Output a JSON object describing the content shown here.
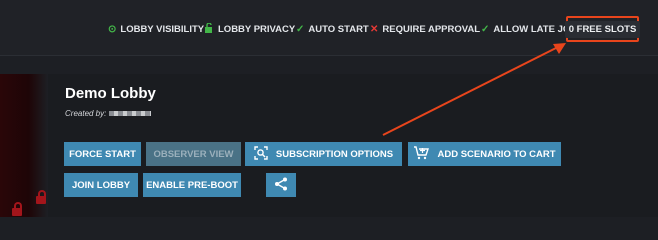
{
  "status_bar": {
    "items": [
      {
        "label": "LOBBY VISIBILITY",
        "icon": "eye-icon"
      },
      {
        "label": "LOBBY PRIVACY",
        "icon": "unlock-icon"
      },
      {
        "label": "AUTO START",
        "icon": "check-icon"
      },
      {
        "label": "REQUIRE APPROVAL",
        "icon": "x-icon"
      },
      {
        "label": "ALLOW LATE JOIN",
        "icon": "check-icon"
      }
    ],
    "free_slots": "0 FREE SLOTS"
  },
  "lobby": {
    "title": "Demo Lobby",
    "created_by_label": "Created by:"
  },
  "buttons": {
    "force_start": "FORCE START",
    "observer_view": "OBSERVER VIEW",
    "subscription_options": "SUBSCRIPTION OPTIONS",
    "add_scenario_to_cart": "ADD SCENARIO TO CART",
    "join_lobby": "JOIN LOBBY",
    "enable_pre_boot": "ENABLE PRE-BOOT"
  },
  "colors": {
    "accent_button": "#3f89b2",
    "highlight": "#e8451c",
    "status_check": "#43b649",
    "status_x": "#e53935"
  }
}
